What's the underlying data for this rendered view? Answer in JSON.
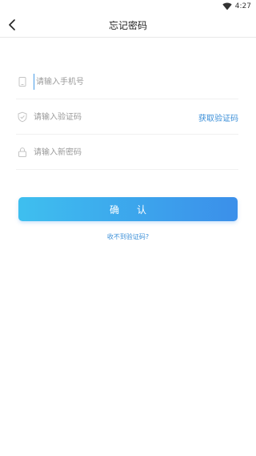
{
  "status_bar": {
    "time": "4:27",
    "wifi_icon": "wifi-icon"
  },
  "nav": {
    "title": "忘记密码",
    "back_icon": "chevron-left-icon"
  },
  "form": {
    "phone": {
      "icon": "phone-icon",
      "placeholder": "请输入手机号",
      "value": ""
    },
    "code": {
      "icon": "shield-icon",
      "placeholder": "请输入验证码",
      "value": "",
      "get_code_label": "获取验证码"
    },
    "password": {
      "icon": "lock-icon",
      "placeholder": "请输入新密码",
      "value": ""
    }
  },
  "confirm_label": "确认",
  "no_code_link": "收不到验证码?",
  "colors": {
    "accent": "#3b8fd8",
    "button_start": "#3ebfef",
    "button_end": "#3b8fea"
  }
}
